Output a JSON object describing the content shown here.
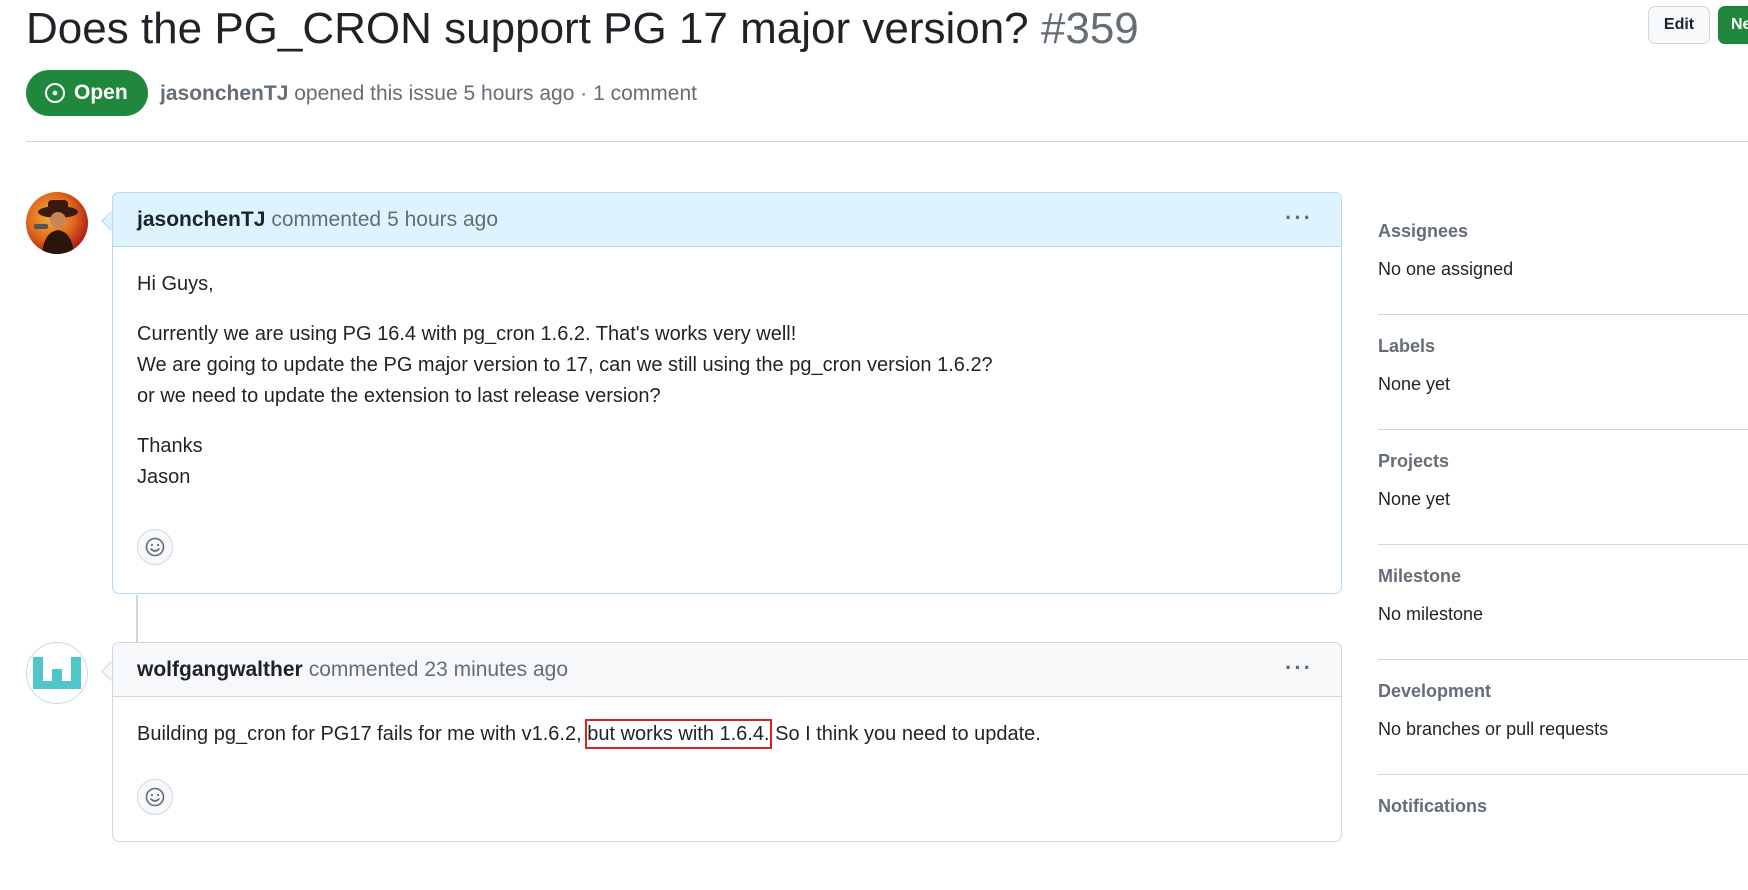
{
  "issue": {
    "title": "Does the PG_CRON support PG 17 major version?",
    "number": "#359",
    "state": "Open",
    "author": "jasonchenTJ",
    "opened_text": "opened this issue 5 hours ago · 1 comment"
  },
  "header_buttons": {
    "edit": "Edit",
    "new": "Ne"
  },
  "comments": [
    {
      "author": "jasonchenTJ",
      "verb": "commented",
      "time": "5 hours ago",
      "menu": "···",
      "body": {
        "line1": "Hi Guys,",
        "line2": "Currently we are using PG 16.4 with pg_cron 1.6.2. That's works very well!",
        "line3": "We are going to update the PG major version to 17, can we still using the pg_cron version 1.6.2?",
        "line4": "or we need to update the extension to last release version?",
        "line5": "Thanks",
        "line6": "Jason"
      }
    },
    {
      "author": "wolfgangwalther",
      "verb": "commented",
      "time": "23 minutes ago",
      "menu": "···",
      "body": {
        "before": "Building pg_cron for PG17 fails for me with v1.6.2, ",
        "highlight": "but works with 1.6.4.",
        "after": " So I think you need to update."
      }
    }
  ],
  "sidebar": {
    "assignees": {
      "heading": "Assignees",
      "value": "No one assigned"
    },
    "labels": {
      "heading": "Labels",
      "value": "None yet"
    },
    "projects": {
      "heading": "Projects",
      "value": "None yet"
    },
    "milestone": {
      "heading": "Milestone",
      "value": "No milestone"
    },
    "development": {
      "heading": "Development",
      "value": "No branches or pull requests"
    },
    "notifications": {
      "heading": "Notifications"
    }
  },
  "colors": {
    "open_green": "#1f883d",
    "author_comment_bg": "#ddf4ff",
    "highlight_border": "#e02020"
  },
  "icons": [
    "issue-opened-icon",
    "kebab-menu-icon",
    "smiley-icon",
    "avatar-jasonchentj",
    "avatar-wolfgangwalther"
  ]
}
